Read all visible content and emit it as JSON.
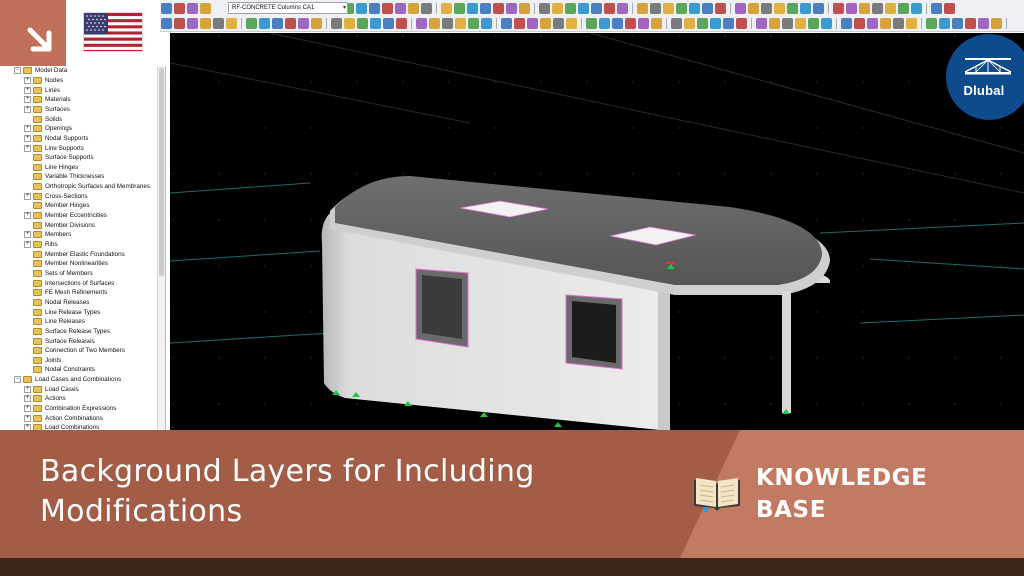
{
  "toolbar": {
    "load_case_select": "RF-CONCRETE Columns CA1"
  },
  "navigator": {
    "items": [
      {
        "label": "Model Data",
        "level": 0,
        "expander": "−"
      },
      {
        "label": "Nodes",
        "level": 1,
        "expander": "+"
      },
      {
        "label": "Lines",
        "level": 1,
        "expander": "+"
      },
      {
        "label": "Materials",
        "level": 1,
        "expander": "+"
      },
      {
        "label": "Surfaces",
        "level": 1,
        "expander": "+"
      },
      {
        "label": "Solids",
        "level": 1,
        "expander": ""
      },
      {
        "label": "Openings",
        "level": 1,
        "expander": "+"
      },
      {
        "label": "Nodal Supports",
        "level": 1,
        "expander": "+"
      },
      {
        "label": "Line Supports",
        "level": 1,
        "expander": "+"
      },
      {
        "label": "Surface Supports",
        "level": 1,
        "expander": ""
      },
      {
        "label": "Line Hinges",
        "level": 1,
        "expander": ""
      },
      {
        "label": "Variable Thicknesses",
        "level": 1,
        "expander": ""
      },
      {
        "label": "Orthotropic Surfaces and Membranes",
        "level": 1,
        "expander": ""
      },
      {
        "label": "Cross-Sections",
        "level": 1,
        "expander": "+"
      },
      {
        "label": "Member Hinges",
        "level": 1,
        "expander": ""
      },
      {
        "label": "Member Eccentricities",
        "level": 1,
        "expander": "+"
      },
      {
        "label": "Member Divisions",
        "level": 1,
        "expander": ""
      },
      {
        "label": "Members",
        "level": 1,
        "expander": "+"
      },
      {
        "label": "Ribs",
        "level": 1,
        "expander": "+"
      },
      {
        "label": "Member Elastic Foundations",
        "level": 1,
        "expander": ""
      },
      {
        "label": "Member Nonlinearities",
        "level": 1,
        "expander": ""
      },
      {
        "label": "Sets of Members",
        "level": 1,
        "expander": ""
      },
      {
        "label": "Intersections of Surfaces",
        "level": 1,
        "expander": ""
      },
      {
        "label": "FE Mesh Refinements",
        "level": 1,
        "expander": ""
      },
      {
        "label": "Nodal Releases",
        "level": 1,
        "expander": ""
      },
      {
        "label": "Line Release Types",
        "level": 1,
        "expander": ""
      },
      {
        "label": "Line Releases",
        "level": 1,
        "expander": ""
      },
      {
        "label": "Surface Release Types",
        "level": 1,
        "expander": ""
      },
      {
        "label": "Surface Releases",
        "level": 1,
        "expander": ""
      },
      {
        "label": "Connection of Two Members",
        "level": 1,
        "expander": ""
      },
      {
        "label": "Joints",
        "level": 1,
        "expander": ""
      },
      {
        "label": "Nodal Constraints",
        "level": 1,
        "expander": ""
      },
      {
        "label": "Load Cases and Combinations",
        "level": 0,
        "expander": "−"
      },
      {
        "label": "Load Cases",
        "level": 1,
        "expander": "+"
      },
      {
        "label": "Actions",
        "level": 1,
        "expander": "+"
      },
      {
        "label": "Combination Expressions",
        "level": 1,
        "expander": "+"
      },
      {
        "label": "Action Combinations",
        "level": 1,
        "expander": "+"
      },
      {
        "label": "Load Combinations",
        "level": 1,
        "expander": "+"
      }
    ]
  },
  "logo": {
    "text": "Dlubal"
  },
  "banner": {
    "title_line1": "Background Layers for Including",
    "title_line2": "Modifications",
    "kb_line1": "KNOWLEDGE",
    "kb_line2": "BASE"
  },
  "icons": {
    "corner": "arrow-down-right-icon",
    "flag": "us-flag-icon",
    "logo": "bridge-icon",
    "book": "open-book-icon"
  },
  "colors": {
    "banner": "#a35c46",
    "banner_accent": "#c27b62",
    "corner": "#c0705a",
    "logo": "#0d4b8c",
    "viewport_bg": "#000000"
  }
}
